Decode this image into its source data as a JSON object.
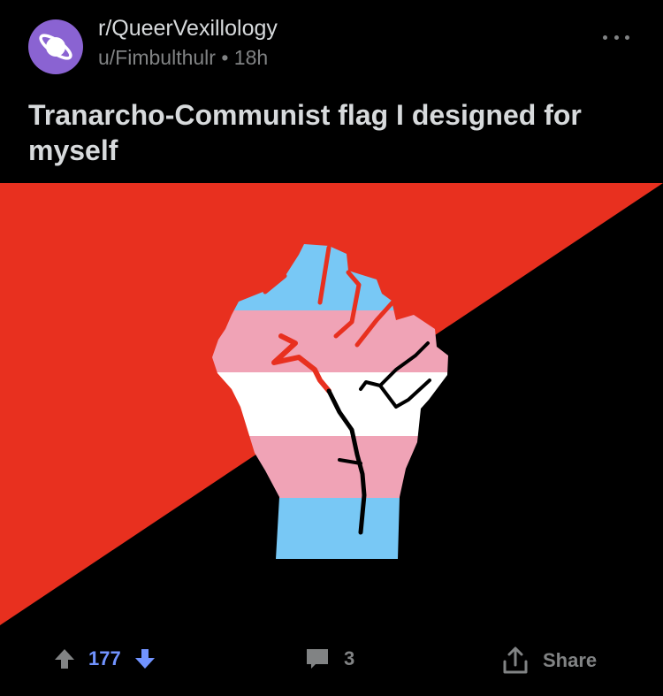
{
  "post": {
    "subreddit": "r/QueerVexillology",
    "author": "u/Fimbulthulr",
    "separator": "•",
    "age": "18h",
    "title": "Tranarcho-Communist flag I designed for myself"
  },
  "flag_image": {
    "colors": {
      "red": "#e8301f",
      "black": "#000000",
      "trans_blue": "#78c8f5",
      "trans_pink": "#f0a3b6",
      "trans_white": "#ffffff"
    }
  },
  "actions": {
    "vote_count": "177",
    "comment_count": "3",
    "share_label": "Share"
  },
  "colors": {
    "avatar_bg": "#8a63d2",
    "upvote_grey": "#818384",
    "downvote_blue": "#7193ff"
  }
}
